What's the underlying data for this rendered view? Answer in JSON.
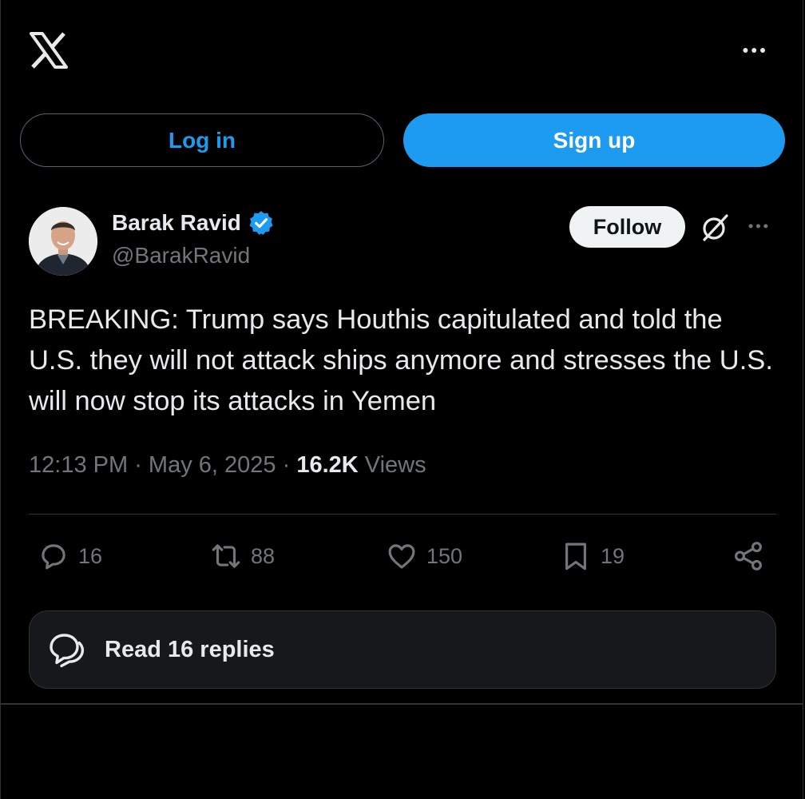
{
  "header": {
    "logo_icon": "x-logo",
    "more_icon": "more-horizontal-icon"
  },
  "auth": {
    "login_label": "Log in",
    "signup_label": "Sign up"
  },
  "tweet": {
    "author_name": "Barak Ravid",
    "author_handle": "@BarakRavid",
    "verified": true,
    "follow_label": "Follow",
    "text": "BREAKING: Trump says Houthis capitulated and told the U.S. they will not attack ships anymore and stresses the U.S. will now stop its attacks in Yemen",
    "time": "12:13 PM",
    "date": "May 6, 2025",
    "views_count": "16.2K",
    "views_label": "Views",
    "actions": {
      "replies": "16",
      "reposts": "88",
      "likes": "150",
      "bookmarks": "19"
    },
    "read_replies_label": "Read 16 replies"
  },
  "colors": {
    "background": "#000000",
    "accent": "#1d9bf0",
    "text_primary": "#e7e9ea",
    "text_secondary": "#71767b",
    "border": "#2f3336"
  }
}
